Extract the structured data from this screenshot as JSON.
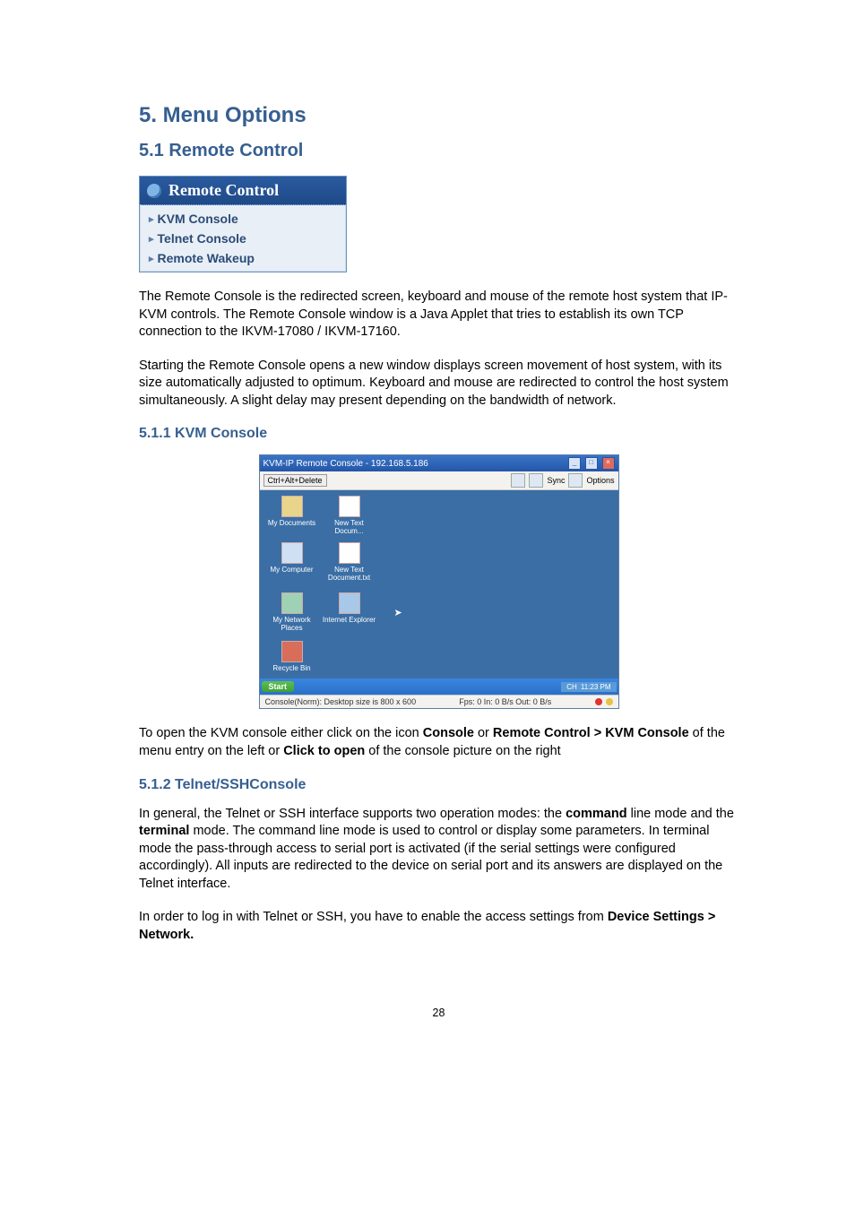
{
  "h1": "5. Menu Options",
  "h2": "5.1 Remote Control",
  "rc_panel": {
    "title": "Remote Control",
    "items": [
      "KVM Console",
      "Telnet Console",
      "Remote Wakeup"
    ]
  },
  "para1": "The Remote Console is the redirected screen, keyboard and mouse of the remote host system that IP-KVM controls. The Remote Console window is a Java Applet that tries to establish its own TCP connection to the IKVM-17080 / IKVM-17160.",
  "para2": "Starting the Remote Console opens a new window displays screen movement of host system, with its size automatically adjusted to optimum. Keyboard and mouse are redirected to control the host system simultaneously. A slight delay may present depending on the bandwidth of network.",
  "h3a": "5.1.1 KVM Console",
  "kvm": {
    "title": "KVM-IP  Remote Console - 192.168.5.186",
    "cad": "Ctrl+Alt+Delete",
    "sync": "Sync",
    "options": "Options",
    "icons": {
      "my_documents": "My Documents",
      "new_text_docum": "New Text Docum...",
      "my_computer": "My Computer",
      "new_text_document": "New Text Document.txt",
      "my_network_places": "My Network Places",
      "internet_explorer": "Internet Explorer",
      "recycle_bin": "Recycle Bin"
    },
    "start": "Start",
    "tray_lang": "CH",
    "clock": "11:23 PM",
    "status_left": "Console(Norm): Desktop size is 800 x 600",
    "status_right": "Fps: 0 In: 0 B/s Out: 0 B/s"
  },
  "para3_pre": "To open the KVM console either click on the icon ",
  "para3_b1": "Console",
  "para3_mid1": " or ",
  "para3_b2": "Remote Control > KVM Console",
  "para3_mid2": " of the menu entry on the left or ",
  "para3_b3": "Click to open",
  "para3_post": " of the console picture on the right",
  "h3b": "5.1.2 Telnet/SSHConsole",
  "para4_pre": "In general, the Telnet or SSH interface supports two operation modes: the ",
  "para4_b1": "command",
  "para4_mid1": " line mode and the ",
  "para4_b2": "terminal",
  "para4_post": " mode. The command line mode is used to control or display some parameters. In terminal mode the pass-through access to serial port is activated (if the serial settings were configured accordingly). All inputs are redirected to the device on serial port and its answers are displayed on the Telnet interface.",
  "para5_pre": "In order to log in with Telnet or SSH, you have to enable the access settings from ",
  "para5_b1": "Device Settings > Network.",
  "pagenum": "28"
}
